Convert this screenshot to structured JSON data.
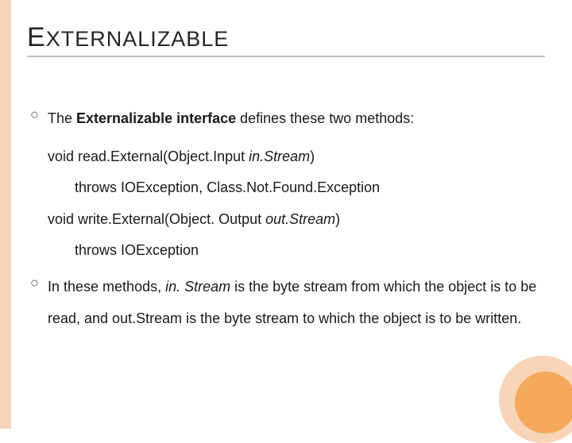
{
  "title": {
    "first_cap": "E",
    "rest": "XTERNALIZABLE"
  },
  "bullet1": {
    "pre": "The ",
    "bold": "Externalizable interface ",
    "post": "defines these two methods:"
  },
  "code": {
    "sig1_a": "void read.External(Object.Input ",
    "sig1_b": "in.Stream",
    "sig1_c": ")",
    "throws1": "throws IOException, Class.Not.Found.Exception",
    "sig2_a": "void write.External(Object. Output ",
    "sig2_b": "out.Stream",
    "sig2_c": ")",
    "throws2": "throws IOException"
  },
  "bullet2": {
    "a": "In these methods, ",
    "b": "in. Stream ",
    "c": "is the byte stream from which the object is to be read, and out.Stream is the byte stream to which the object is to be written."
  }
}
